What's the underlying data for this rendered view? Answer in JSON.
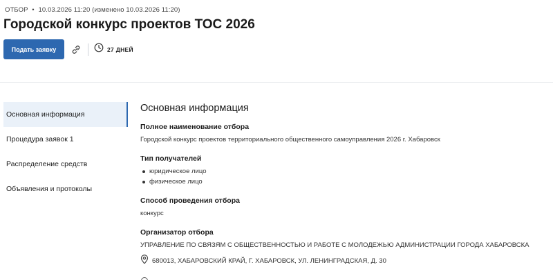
{
  "header": {
    "category": "ОТБОР",
    "separator": "•",
    "timestamp": "10.03.2026 11:20 (изменено 10.03.2026 11:20)",
    "title": "Городской конкурс проектов ТОС 2026"
  },
  "actions": {
    "apply_label": "Подать заявку",
    "link_icon": "link-icon",
    "clock_icon": "clock-icon",
    "days_left": "27 ДНЕЙ"
  },
  "sidebar": {
    "items": [
      {
        "label": "Основная информация",
        "active": true
      },
      {
        "label": "Процедура заявок 1",
        "active": false
      },
      {
        "label": "Распределение средств",
        "active": false
      },
      {
        "label": "Объявления и протоколы",
        "active": false
      }
    ]
  },
  "main": {
    "heading": "Основная информация",
    "full_name": {
      "label": "Полное наименование отбора",
      "value": "Городской конкурс проектов территориального общественного самоуправления 2026 г. Хабаровск"
    },
    "recipients": {
      "label": "Тип получателей",
      "items": [
        "юридическое лицо",
        "физическое лицо"
      ]
    },
    "method": {
      "label": "Способ проведения отбора",
      "value": "конкурс"
    },
    "organizer": {
      "label": "Организатор отбора",
      "value": "УПРАВЛЕНИЕ ПО СВЯЗЯМ С ОБЩЕСТВЕННОСТЬЮ И РАБОТЕ С МОЛОДЕЖЬЮ АДМИНИСТРАЦИИ ГОРОДА ХАБАРОВСКА",
      "address": "680013, ХАБАРОВСКИЙ КРАЙ, Г. ХАБАРОВСК, УЛ. ЛЕНИНГРАДСКАЯ, Д. 30"
    }
  },
  "colors": {
    "accent": "#2d68b0",
    "active_bg": "#eaf1f9"
  }
}
